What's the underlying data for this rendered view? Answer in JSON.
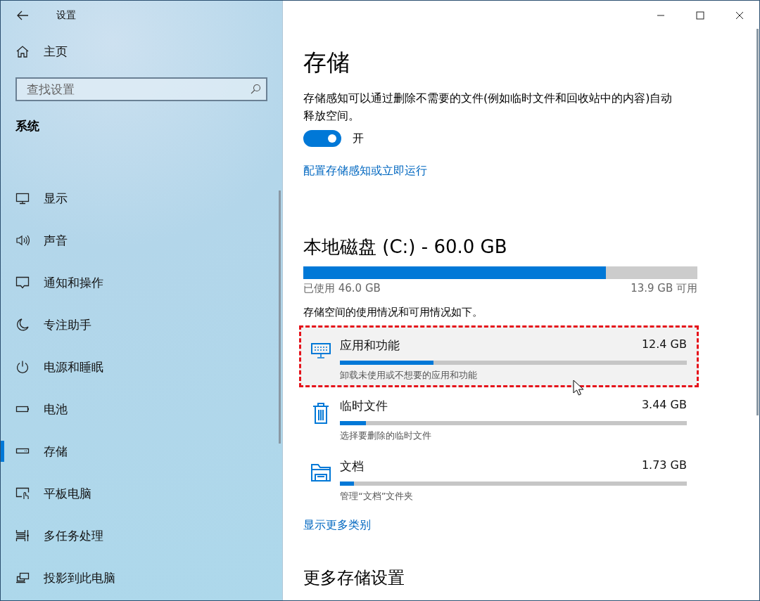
{
  "window": {
    "title": "设置"
  },
  "sidebar": {
    "home": "主页",
    "search": {
      "placeholder": "查找设置"
    },
    "section": "系统",
    "items": [
      {
        "label": "显示",
        "kind": "display",
        "selected": false
      },
      {
        "label": "声音",
        "kind": "sound",
        "selected": false
      },
      {
        "label": "通知和操作",
        "kind": "notification",
        "selected": false
      },
      {
        "label": "专注助手",
        "kind": "focus",
        "selected": false
      },
      {
        "label": "电源和睡眠",
        "kind": "power",
        "selected": false
      },
      {
        "label": "电池",
        "kind": "battery",
        "selected": false
      },
      {
        "label": "存储",
        "kind": "storage",
        "selected": true
      },
      {
        "label": "平板电脑",
        "kind": "tablet",
        "selected": false
      },
      {
        "label": "多任务处理",
        "kind": "multitask",
        "selected": false
      },
      {
        "label": "投影到此电脑",
        "kind": "project",
        "selected": false
      }
    ]
  },
  "main": {
    "title": "存储",
    "description": "存储感知可以通过删除不需要的文件(例如临时文件和回收站中的内容)自动释放空间。",
    "toggle": {
      "on": true,
      "label": "开"
    },
    "link": "配置存储感知或立即运行",
    "drive": {
      "heading": "本地磁盘 (C:) - 60.0 GB",
      "level": 0.768,
      "used": "已使用 46.0 GB",
      "free": "13.9 GB 可用"
    },
    "usage_note": "存储空间的使用情况和可用情况如下。",
    "categories": [
      {
        "name": "应用和功能",
        "size": "12.4 GB",
        "level": 0.27,
        "hint": "卸载未使用或不想要的应用和功能",
        "kind": "apps",
        "highlighted": true
      },
      {
        "name": "临时文件",
        "size": "3.44 GB",
        "level": 0.075,
        "hint": "选择要删除的临时文件",
        "kind": "temp",
        "highlighted": false
      },
      {
        "name": "文档",
        "size": "1.73 GB",
        "level": 0.04,
        "hint": "管理“文档”文件夹",
        "kind": "documents",
        "highlighted": false
      }
    ],
    "more_link": "显示更多类别",
    "more_heading": "更多存储设置"
  }
}
